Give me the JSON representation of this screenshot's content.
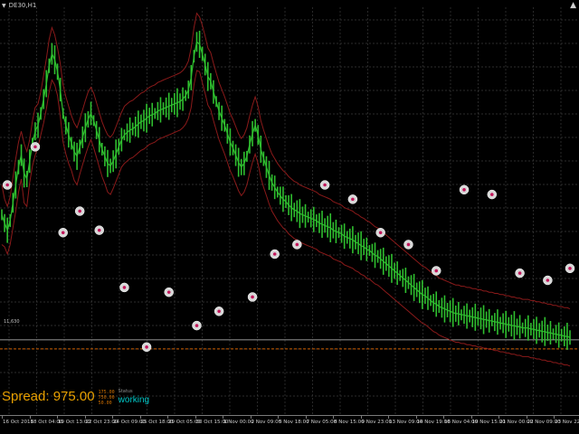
{
  "window": {
    "symbol_label": "DE30,H1",
    "dropdown_glyph": "▼",
    "corner_glyph": "▲"
  },
  "hud": {
    "spread_text": "Spread: 975.00",
    "mini_lines": [
      "175.00",
      "750.00",
      "50.00"
    ],
    "status_label": "Status",
    "status_value": "working"
  },
  "price_tag": "11,630",
  "colors": {
    "background": "#000000",
    "price": "#2fbf2f",
    "bands": "#8b1a1a",
    "grid": "#3a3a3a",
    "level_line": "#c8c8c8",
    "level_dash": "#d06000",
    "spread": "#e8a000",
    "status": "#00c8c8"
  },
  "time_axis": [
    "16 Oct 2018",
    "18 Oct 04:00",
    "19 Oct 13:00",
    "22 Oct 23:00",
    "24 Oct 09:00",
    "25 Oct 18:00",
    "29 Oct 05:00",
    "30 Oct 15:00",
    "1 Nov 00:00",
    "2 Nov 09:00",
    "5 Nov 18:00",
    "7 Nov 05:00",
    "8 Nov 15:00",
    "9 Nov 23:00",
    "13 Nov 09:00",
    "14 Nov 19:00",
    "16 Nov 04:00",
    "19 Nov 15:00",
    "21 Nov 00:00",
    "22 Nov 09:00",
    "23 Nov 22:00"
  ],
  "chart_data": {
    "type": "line",
    "series": [
      {
        "values": [
          165,
          158,
          152,
          160,
          175,
          190,
          205,
          215,
          200,
          195,
          210,
          225,
          235,
          240,
          250,
          262,
          275,
          290,
          300,
          295,
          285,
          270,
          250,
          240,
          232,
          225,
          218,
          214,
          222,
          230,
          238,
          245,
          250,
          244,
          236,
          228,
          220,
          214,
          208,
          206,
          210,
          216,
          222,
          228,
          232,
          234,
          236,
          237,
          239,
          241,
          243,
          244,
          246,
          248,
          249,
          250,
          252,
          253,
          254,
          255,
          256,
          257,
          258,
          259,
          260,
          262,
          265,
          270,
          280,
          298,
          310,
          308,
          300,
          291,
          281,
          277,
          268,
          260,
          252,
          246,
          240,
          233,
          226,
          221,
          215,
          209,
          205,
          208,
          214,
          224,
          233,
          240,
          232,
          220,
          212,
          205,
          198,
          192,
          188,
          184,
          181,
          178,
          176,
          173,
          171,
          169,
          168,
          166,
          165,
          164,
          163,
          162,
          161,
          160,
          158,
          157,
          156,
          155,
          154,
          152,
          151,
          150,
          149,
          147,
          146,
          145,
          144,
          142,
          141,
          139,
          138,
          136,
          135,
          133,
          131,
          130,
          128,
          126,
          124,
          122,
          120,
          118,
          116,
          114,
          112,
          110,
          108,
          106,
          104,
          102,
          100,
          98,
          97,
          95,
          93,
          91,
          90,
          88,
          87,
          86,
          85,
          84,
          83,
          82,
          82,
          81,
          81,
          80,
          80,
          79,
          79,
          78,
          78,
          77,
          77,
          76,
          76,
          75,
          75,
          74,
          74,
          73,
          73,
          72,
          72,
          71,
          71,
          70,
          70,
          70,
          69,
          69,
          68,
          68,
          67,
          67,
          66,
          66,
          65,
          65,
          64,
          64,
          63,
          63,
          62
        ]
      }
    ],
    "bands": {
      "upper": [
        190,
        178,
        172,
        180,
        196,
        212,
        226,
        235,
        225,
        218,
        228,
        244,
        255,
        258,
        268,
        282,
        296,
        312,
        322,
        316,
        305,
        292,
        274,
        264,
        256,
        248,
        242,
        238,
        245,
        253,
        261,
        268,
        272,
        267,
        259,
        251,
        243,
        237,
        232,
        230,
        233,
        239,
        245,
        251,
        256,
        258,
        260,
        261,
        263,
        265,
        267,
        268,
        270,
        272,
        273,
        274,
        276,
        277,
        278,
        279,
        280,
        281,
        282,
        283,
        284,
        286,
        289,
        294,
        305,
        322,
        334,
        331,
        324,
        315,
        305,
        301,
        292,
        284,
        276,
        270,
        264,
        257,
        250,
        245,
        239,
        233,
        229,
        232,
        238,
        248,
        257,
        264,
        256,
        244,
        236,
        229,
        222,
        216,
        212,
        208,
        205,
        202,
        200,
        197,
        195,
        193,
        192,
        190,
        189,
        188,
        187,
        186,
        185,
        184,
        182,
        181,
        180,
        179,
        178,
        176,
        175,
        174,
        173,
        171,
        170,
        169,
        168,
        166,
        165,
        163,
        162,
        160,
        159,
        157,
        155,
        154,
        152,
        150,
        148,
        146,
        144,
        142,
        140,
        138,
        136,
        134,
        132,
        130,
        128,
        126,
        124,
        122,
        121,
        119,
        117,
        115,
        114,
        112,
        111,
        110,
        109,
        108,
        107,
        106,
        106,
        105,
        105,
        104,
        104,
        103,
        103,
        102,
        102,
        101,
        101,
        100,
        100,
        99,
        99,
        98,
        98,
        97,
        97,
        96,
        96,
        95,
        95,
        94,
        94,
        94,
        93,
        93,
        92,
        92,
        91,
        91,
        90,
        90,
        89,
        89,
        88,
        88,
        87,
        87,
        86
      ],
      "lower": [
        140,
        138,
        132,
        140,
        154,
        168,
        184,
        195,
        175,
        172,
        192,
        206,
        215,
        222,
        232,
        242,
        254,
        268,
        278,
        274,
        265,
        248,
        226,
        216,
        208,
        202,
        194,
        190,
        199,
        207,
        215,
        222,
        228,
        221,
        213,
        205,
        197,
        191,
        184,
        182,
        187,
        193,
        199,
        205,
        208,
        210,
        212,
        213,
        215,
        217,
        219,
        220,
        222,
        224,
        225,
        226,
        228,
        229,
        230,
        231,
        232,
        233,
        234,
        235,
        236,
        238,
        241,
        246,
        255,
        274,
        286,
        285,
        276,
        267,
        257,
        253,
        244,
        236,
        228,
        222,
        216,
        209,
        202,
        197,
        191,
        185,
        181,
        184,
        190,
        200,
        209,
        216,
        208,
        196,
        188,
        181,
        174,
        168,
        164,
        160,
        157,
        154,
        152,
        149,
        147,
        145,
        144,
        142,
        141,
        140,
        139,
        138,
        137,
        136,
        134,
        133,
        132,
        131,
        130,
        128,
        127,
        126,
        125,
        123,
        122,
        121,
        120,
        118,
        117,
        115,
        114,
        112,
        111,
        109,
        107,
        106,
        104,
        102,
        100,
        98,
        96,
        94,
        92,
        90,
        88,
        86,
        84,
        82,
        80,
        78,
        76,
        74,
        73,
        71,
        69,
        67,
        66,
        64,
        63,
        62,
        61,
        60,
        59,
        58,
        58,
        57,
        57,
        56,
        56,
        55,
        55,
        54,
        54,
        53,
        53,
        52,
        52,
        51,
        51,
        50,
        50,
        49,
        49,
        48,
        48,
        47,
        47,
        46,
        46,
        46,
        45,
        45,
        44,
        44,
        43,
        43,
        42,
        42,
        41,
        41,
        40,
        40,
        39,
        39,
        38
      ]
    },
    "signals": [
      {
        "i": 2,
        "v": 190
      },
      {
        "i": 12,
        "v": 222
      },
      {
        "i": 22,
        "v": 150
      },
      {
        "i": 28,
        "v": 168
      },
      {
        "i": 35,
        "v": 152
      },
      {
        "i": 44,
        "v": 104
      },
      {
        "i": 52,
        "v": 54
      },
      {
        "i": 60,
        "v": 100
      },
      {
        "i": 70,
        "v": 72
      },
      {
        "i": 78,
        "v": 84
      },
      {
        "i": 90,
        "v": 96
      },
      {
        "i": 98,
        "v": 132
      },
      {
        "i": 106,
        "v": 140
      },
      {
        "i": 116,
        "v": 190
      },
      {
        "i": 126,
        "v": 178
      },
      {
        "i": 136,
        "v": 150
      },
      {
        "i": 146,
        "v": 140
      },
      {
        "i": 156,
        "v": 118
      },
      {
        "i": 166,
        "v": 186
      },
      {
        "i": 176,
        "v": 182
      },
      {
        "i": 186,
        "v": 116
      },
      {
        "i": 196,
        "v": 110
      },
      {
        "i": 204,
        "v": 120
      }
    ],
    "ylim": [
      0,
      330
    ],
    "level_value": 60,
    "grid": true
  }
}
